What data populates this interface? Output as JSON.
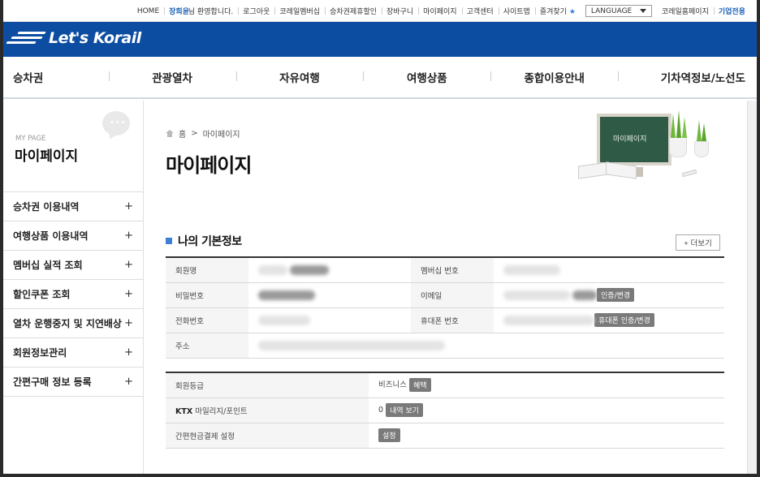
{
  "util": {
    "home": "HOME",
    "user_name": "장희윤",
    "welcome": "님 환영합니다.",
    "logout": "로그아웃",
    "membership": "코레일멤버십",
    "discount": "승차권제휴할인",
    "cart": "장바구니",
    "mypage": "마이페이지",
    "customer": "고객센터",
    "sitemap": "사이트맵",
    "favorites": "즐겨찾기",
    "language": "LANGUAGE",
    "korail_home": "코레일홈페이지",
    "corporate": "기업전용"
  },
  "logo": {
    "text": "Let's Korail"
  },
  "gnb": [
    "승차권",
    "관광열차",
    "자유여행",
    "여행상품",
    "종합이용안내",
    "기차역정보/노선도"
  ],
  "sidebar": {
    "label_small": "MY PAGE",
    "title": "마이페이지",
    "items": [
      {
        "label": "승차권 이용내역",
        "icon": "+"
      },
      {
        "label": "여행상품 이용내역",
        "icon": "+"
      },
      {
        "label": "멤버십 실적 조회",
        "icon": "+"
      },
      {
        "label": "할인쿠폰 조회",
        "icon": "+"
      },
      {
        "label": "열차 운행중지 및 지연배상",
        "icon": "+"
      },
      {
        "label": "회원정보관리",
        "icon": "+"
      },
      {
        "label": "간편구매 정보 등록",
        "icon": "+"
      }
    ]
  },
  "breadcrumb": {
    "home": "홈",
    "sep": ">",
    "current": "마이페이지"
  },
  "page_title": "마이페이지",
  "illustration": {
    "board_text": "마이페이지"
  },
  "section": {
    "title": "나의 기본정보",
    "more": "+ 더보기"
  },
  "info": {
    "member_name_label": "회원명",
    "membership_no_label": "멤버십 번호",
    "password_label": "비밀번호",
    "email_label": "이메일",
    "email_button": "인증/변경",
    "phone_label": "전화번호",
    "mobile_label": "휴대폰 번호",
    "mobile_button": "휴대폰 인증/변경",
    "address_label": "주소"
  },
  "grade": {
    "grade_label": "회원등급",
    "grade_value": "비즈니스",
    "benefit_button": "혜택",
    "mileage_label_bold": "KTX",
    "mileage_label": "마일리지/포인트",
    "mileage_value": "0",
    "history_button": "내역 보기",
    "easypay_label": "간편현금결제 설정",
    "easypay_button": "설정"
  },
  "colors": {
    "brand_blue": "#0d4da1",
    "accent_blue": "#3f7fd8",
    "tag_gray": "#7a7a7a"
  }
}
